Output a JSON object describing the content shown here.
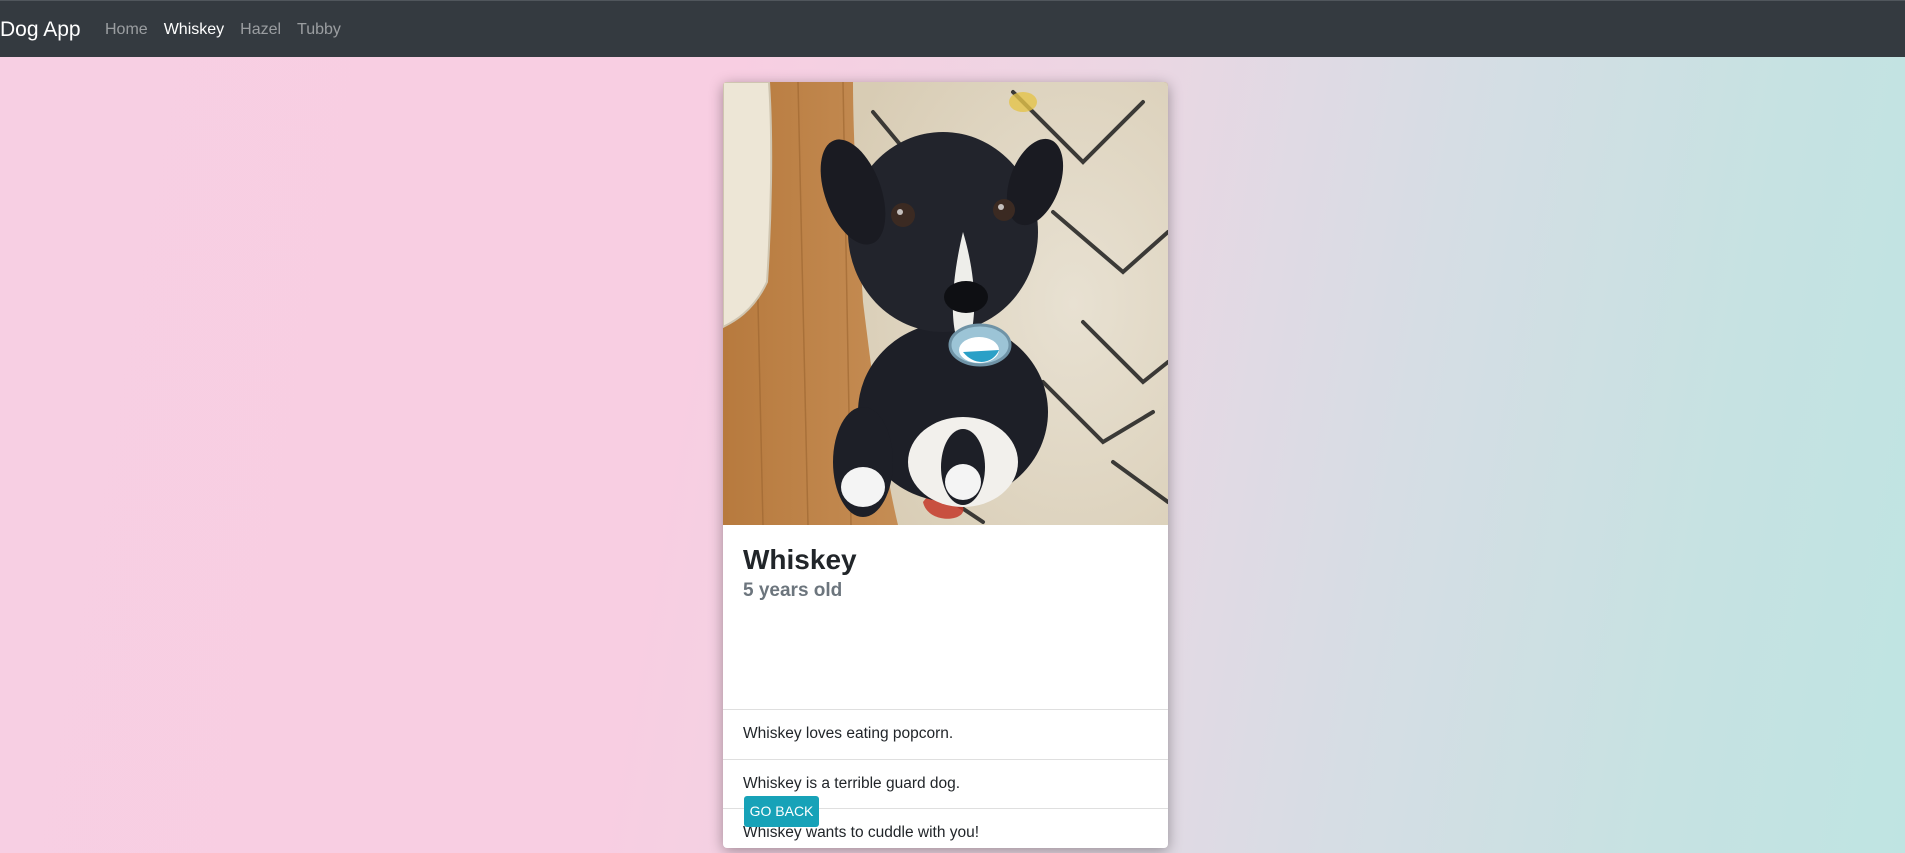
{
  "navbar": {
    "brand": "Dog App",
    "links": [
      {
        "label": "Home",
        "active": false
      },
      {
        "label": "Whiskey",
        "active": true
      },
      {
        "label": "Hazel",
        "active": false
      },
      {
        "label": "Tubby",
        "active": false
      }
    ]
  },
  "dog": {
    "name": "Whiskey",
    "age": "5 years old",
    "facts": [
      "Whiskey loves eating popcorn.",
      "Whiskey is a terrible guard dog.",
      "Whiskey wants to cuddle with you!"
    ],
    "back_label": "GO BACK"
  },
  "colors": {
    "navbar_bg": "#343a40",
    "button_bg": "#17a2b8",
    "gradient_left": "#f8cee2",
    "gradient_right": "#bfe4e2"
  }
}
